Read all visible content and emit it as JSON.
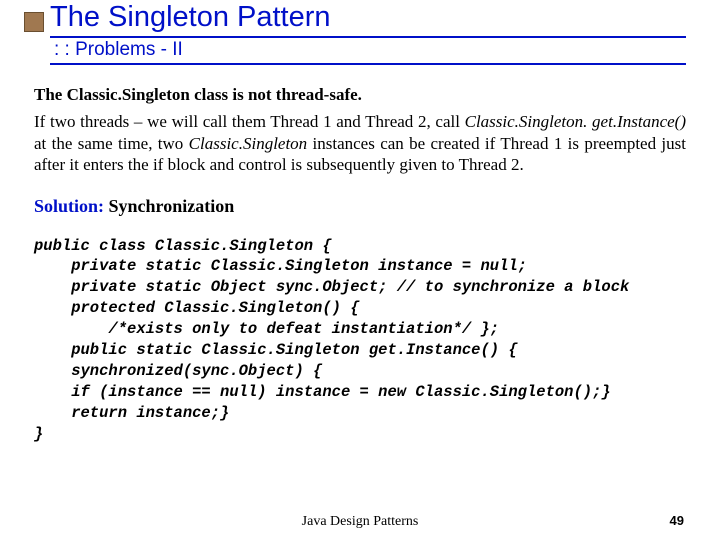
{
  "title": "The Singleton Pattern",
  "subtitle": ": : Problems - II",
  "para1_lead": "The Classic.Singleton class is not thread-safe.",
  "para2_a": "If two threads – we will call them Thread 1 and Thread 2, call ",
  "para2_code1": "Classic.Singleton. get.Instance()",
  "para2_b": " at the same time, two ",
  "para2_code2": "Classic.Singleton",
  "para2_c": " instances can be created if Thread 1 is preempted just after it enters the if block and control is subsequently given to Thread 2.",
  "solution_label": "Solution:",
  "solution_value": " Synchronization",
  "code": "public class Classic.Singleton {\n    private static Classic.Singleton instance = null;\n    private static Object sync.Object; // to synchronize a block\n    protected Classic.Singleton() {\n        /*exists only to defeat instantiation*/ };\n    public static Classic.Singleton get.Instance() {\n    synchronized(sync.Object) {\n    if (instance == null) instance = new Classic.Singleton();}\n    return instance;}\n}",
  "footer": "Java Design Patterns",
  "page": "49"
}
